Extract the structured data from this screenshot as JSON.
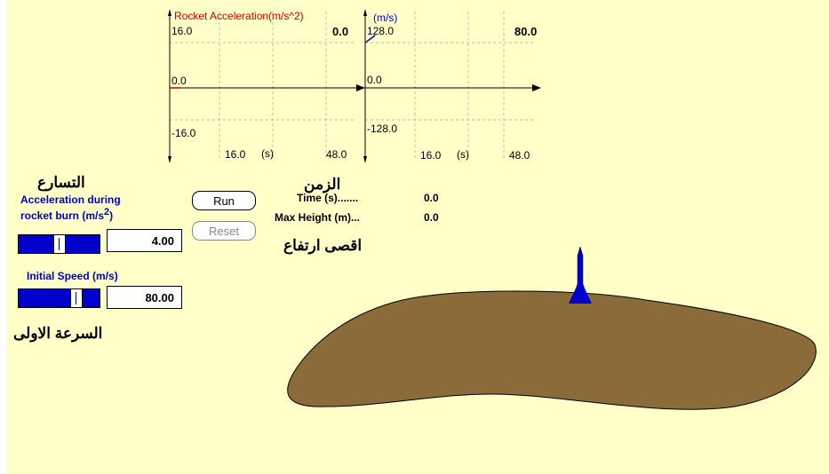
{
  "graphs": [
    {
      "title": "Rocket Acceleration(m/s^2)",
      "title_color": "#cc0000",
      "y_max_label": "16.0",
      "y_zero_label": "0.0",
      "y_min_label": "-16.0",
      "x_tick_label": "16.0",
      "x_unit_label": "(s)",
      "x_end_label": "48.0",
      "current_value": "0.0",
      "x_range": [
        0,
        56
      ],
      "y_range": [
        -16,
        16
      ],
      "grid": true,
      "series": [
        {
          "color": "#cc0000",
          "points": [
            [
              0,
              0
            ],
            [
              3.3,
              0
            ]
          ]
        }
      ]
    },
    {
      "title": "(m/s)",
      "title_color": "#0000cc",
      "y_max_label": "128.0",
      "y_zero_label": "0.0",
      "y_min_label": "-128.0",
      "x_tick_label": "16.0",
      "x_unit_label": "(s)",
      "x_end_label": "48.0",
      "current_value": "80.0",
      "x_range": [
        0,
        56
      ],
      "y_range": [
        -128,
        128
      ],
      "grid": true,
      "series": [
        {
          "color": "#0000cc",
          "points": [
            [
              0,
              80
            ],
            [
              3.3,
              93
            ]
          ]
        }
      ]
    }
  ],
  "buttons": {
    "run": "Run",
    "reset": "Reset"
  },
  "controls": {
    "acceleration": {
      "label_line1": "Acceleration during",
      "label_line2": "rocket burn (m/s",
      "label_sup": "2",
      "label_close": ")",
      "value": "4.00",
      "slider_fraction": 0.5
    },
    "initial_speed": {
      "label": "Initial Speed (m/s)",
      "value": "80.00",
      "slider_fraction": 0.75
    }
  },
  "readouts": {
    "time_label": "Time (s).......",
    "time_value": "0.0",
    "max_height_label": "Max Height (m)...",
    "max_height_value": "0.0"
  },
  "annotations": {
    "acceleration": "التسارع",
    "time": "الزمن",
    "max_height": "اقصى ارتفاع",
    "initial_speed": "السرعة الاولى"
  },
  "colors": {
    "background": "#ffffc8",
    "ground": "#8b6b3a",
    "rocket": "#0000cc",
    "control_blue": "#0000cc"
  }
}
